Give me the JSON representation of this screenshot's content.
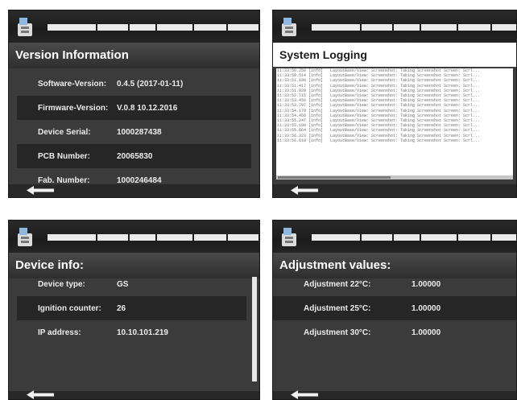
{
  "screens": {
    "version": {
      "title": "Version Information",
      "rows": [
        {
          "label": "Software-Version:",
          "value": "0.4.5 (2017-01-11)"
        },
        {
          "label": "Firmware-Version:",
          "value": "V.0.8 10.12.2016"
        },
        {
          "label": "Device Serial:",
          "value": "1000287438"
        },
        {
          "label": "PCB Number:",
          "value": "20065830"
        },
        {
          "label": "Fab. Number:",
          "value": "1000246484"
        }
      ]
    },
    "logging": {
      "title": "System Logging",
      "lines": [
        {
          "time": "11:33:50.250 [info]",
          "msg": "LayoutBase/View: Screenshot: Taking Screenshot Screen: Scrl..."
        },
        {
          "time": "11:33:50.514 [info]",
          "msg": "LayoutBase/View: Screenshot: Taking Screenshot Screen: Scrl..."
        },
        {
          "time": "11:33:51.100 [info]",
          "msg": "LayoutBase/View: Screenshot: Taking Screenshot Screen: Scrl..."
        },
        {
          "time": "11:33:51.417 [info]",
          "msg": "LayoutBase/View: Screenshot: Taking Screenshot Screen: Scrl..."
        },
        {
          "time": "11:33:51.928 [info]",
          "msg": "LayoutBase/View: Screenshot: Taking Screenshot Screen: Scrl..."
        },
        {
          "time": "11:33:52.715 [info]",
          "msg": "LayoutBase/View: Screenshot: Taking Screenshot Screen: Scrl..."
        },
        {
          "time": "11:33:53.456 [info]",
          "msg": "LayoutBase/View: Screenshot: Taking Screenshot Screen: Scrl..."
        },
        {
          "time": "11:33:53.797 [info]",
          "msg": "LayoutBase/View: Screenshot: Taking Screenshot Screen: Scrl..."
        },
        {
          "time": "11:33:54.170 [info]",
          "msg": "LayoutBase/View: Screenshot: Taking Screenshot Screen: Scrl..."
        },
        {
          "time": "11:33:54.456 [info]",
          "msg": "LayoutBase/View: Screenshot: Taking Screenshot Screen: Scrl..."
        },
        {
          "time": "11:33:55.247 [info]",
          "msg": "LayoutBase/View: Screenshot: Taking Screenshot Screen: Scrl..."
        },
        {
          "time": "11:33:55.100 [info]",
          "msg": "LayoutBase/View: Screenshot: Taking Screenshot Screen: Scrl..."
        },
        {
          "time": "11:33:55.664 [info]",
          "msg": "LayoutBase/View: Screenshot: Taking Screenshot Screen: Scrl..."
        },
        {
          "time": "11:33:56.323 [info]",
          "msg": "LayoutBase/View: Screenshot: Taking Screenshot Screen: Scrl..."
        },
        {
          "time": "11:33:56.618 [info]",
          "msg": "LayoutBase/View: Screenshot: Taking Screenshot Screen: Scrl..."
        }
      ]
    },
    "device": {
      "title": "Device info:",
      "rows": [
        {
          "label": "Device type:",
          "value": "GS"
        },
        {
          "label": "Ignition counter:",
          "value": "26"
        },
        {
          "label": "IP address:",
          "value": "10.10.101.219"
        }
      ]
    },
    "adjustment": {
      "title": "Adjustment values:",
      "rows": [
        {
          "label": "Adjustment 22°C:",
          "value": "1.00000"
        },
        {
          "label": "Adjustment 25°C:",
          "value": "1.00000"
        },
        {
          "label": "Adjustment 30°C:",
          "value": "1.00000"
        }
      ]
    }
  },
  "icons": {
    "device": "device-icon",
    "back": "back-arrow-icon"
  },
  "colors": {
    "panel": "#3b3b3b",
    "row_shade": "#262626",
    "progress": "#eaeaea"
  }
}
